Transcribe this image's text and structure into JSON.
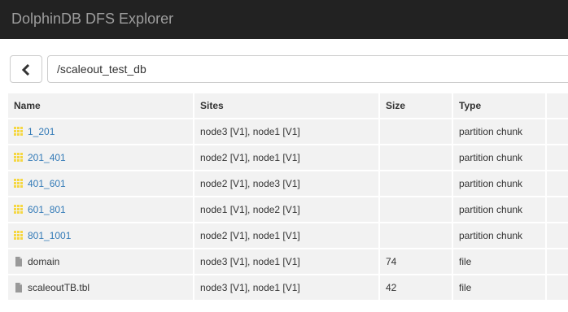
{
  "app": {
    "title": "DolphinDB DFS Explorer"
  },
  "path": {
    "value": "/scaleout_test_db"
  },
  "table": {
    "headers": {
      "name": "Name",
      "sites": "Sites",
      "size": "Size",
      "type": "Type"
    },
    "rows": [
      {
        "name": "1_201",
        "sites": "node3 [V1], node1 [V1]",
        "size": "",
        "type": "partition chunk",
        "kind": "folder"
      },
      {
        "name": "201_401",
        "sites": "node2 [V1], node1 [V1]",
        "size": "",
        "type": "partition chunk",
        "kind": "folder"
      },
      {
        "name": "401_601",
        "sites": "node2 [V1], node3 [V1]",
        "size": "",
        "type": "partition chunk",
        "kind": "folder"
      },
      {
        "name": "601_801",
        "sites": "node1 [V1], node2 [V1]",
        "size": "",
        "type": "partition chunk",
        "kind": "folder"
      },
      {
        "name": "801_1001",
        "sites": "node2 [V1], node1 [V1]",
        "size": "",
        "type": "partition chunk",
        "kind": "folder"
      },
      {
        "name": "domain",
        "sites": "node3 [V1], node1 [V1]",
        "size": "74",
        "type": "file",
        "kind": "file"
      },
      {
        "name": "scaleoutTB.tbl",
        "sites": "node3 [V1], node1 [V1]",
        "size": "42",
        "type": "file",
        "kind": "file"
      }
    ]
  },
  "colors": {
    "navbar_bg": "#222222",
    "brand_text": "#9d9d9d",
    "link": "#337ab7",
    "folder_icon": "#f5d742",
    "file_icon": "#999999",
    "cell_bg": "#f2f2f2"
  },
  "icons": {
    "back": "chevron-left-icon",
    "folder": "grid-folder-icon",
    "file": "file-icon"
  }
}
